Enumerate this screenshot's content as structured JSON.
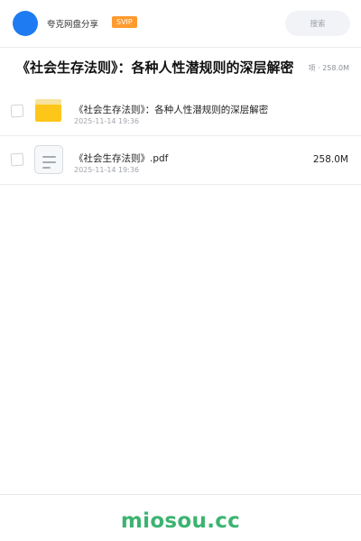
{
  "header": {
    "brand": "夸克网盘分享",
    "badge": "SVIP",
    "search_label": "搜索"
  },
  "share": {
    "title": "《社会生存法则》：各种人性潜规则的深层解密",
    "summary": "项 · 258.0M"
  },
  "files": [
    {
      "type": "folder",
      "icon": "folder-icon",
      "name": "《社会生存法则》：各种人性潜规则的深层解密",
      "date": "2025-11-14 19:36",
      "size": ""
    },
    {
      "type": "pdf",
      "icon": "document-icon",
      "name": "《社会生存法则》.pdf",
      "date": "2025-11-14 19:36",
      "size": "258.0M"
    }
  ],
  "watermark": "miosou.cc",
  "colors": {
    "avatar": "#1f7bf2",
    "badge": "#ff9a2e",
    "folder": "#ffc61a",
    "watermark": "#3cb371"
  }
}
